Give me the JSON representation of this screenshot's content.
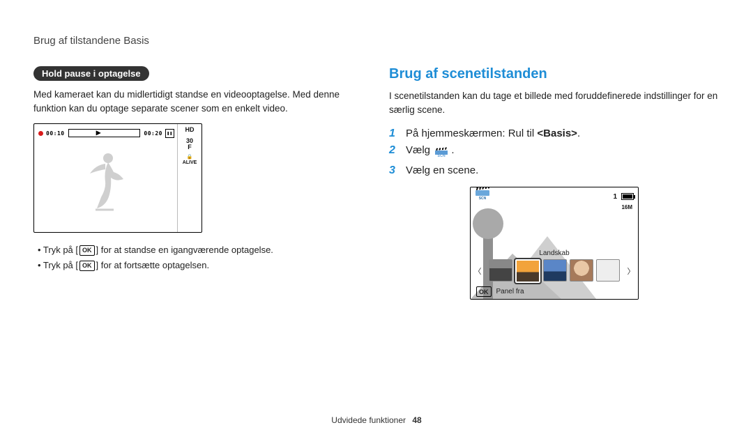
{
  "header": {
    "title": "Brug af tilstandene Basis"
  },
  "left": {
    "pill": "Hold pause i optagelse",
    "intro": "Med kameraet kan du midlertidigt standse en videooptagelse. Med denne funktion kan du optage separate scener som en enkelt video.",
    "lcd": {
      "t_elapsed": "00:10",
      "t_total": "00:20",
      "indicators": {
        "hd": "HD",
        "thirty": "30",
        "f": "F",
        "alive": "ALIVE"
      }
    },
    "bullets": {
      "b1_pre": "• Tryk på [",
      "ok": "OK",
      "b1_post": "] for at standse en igangværende optagelse.",
      "b2_pre": "• Tryk på [",
      "b2_post": "] for at fortsætte optagelsen."
    }
  },
  "right": {
    "heading": "Brug af scenetilstanden",
    "intro": "I scenetilstanden kan du tage et billede med foruddefinerede indstillinger for en særlig scene.",
    "steps": {
      "s1_pre": "På hjemmeskærmen: Rul til ",
      "s1_bold": "<Basis>",
      "s1_post": ".",
      "s2_pre": "Vælg ",
      "s2_post": ".",
      "s3": "Vælg en scene."
    },
    "lcd": {
      "scn": "SCN",
      "shots": "1",
      "res": "16M",
      "strip_label": "Landskab",
      "panel": "Panel fra",
      "ok": "OK"
    }
  },
  "footer": {
    "section": "Udvidede funktioner",
    "page": "48"
  }
}
